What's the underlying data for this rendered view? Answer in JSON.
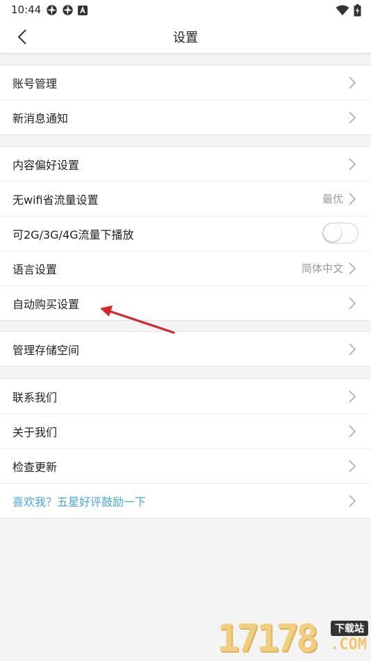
{
  "status_bar": {
    "time": "10:44"
  },
  "header": {
    "title": "设置"
  },
  "groups": [
    {
      "items": [
        {
          "label": "账号管理"
        },
        {
          "label": "新消息通知"
        }
      ]
    },
    {
      "items": [
        {
          "label": "内容偏好设置"
        },
        {
          "label": "无wifi省流量设置",
          "value": "最优"
        },
        {
          "label": "可2G/3G/4G流量下播放",
          "toggle": false
        },
        {
          "label": "语言设置",
          "value": "简体中文"
        },
        {
          "label": "自动购买设置"
        }
      ]
    },
    {
      "items": [
        {
          "label": "管理存储空间"
        }
      ]
    },
    {
      "items": [
        {
          "label": "联系我们"
        },
        {
          "label": "关于我们"
        },
        {
          "label": "检查更新"
        },
        {
          "label": "喜欢我？五星好评鼓励一下"
        }
      ]
    }
  ],
  "watermark": {
    "digits": "17178",
    "badge": "下载站",
    "suffix": ".COM"
  },
  "colors": {
    "highlight_text": "#4aa8d8",
    "annotation_arrow": "#d9252a",
    "watermark": "#f1c76a"
  }
}
